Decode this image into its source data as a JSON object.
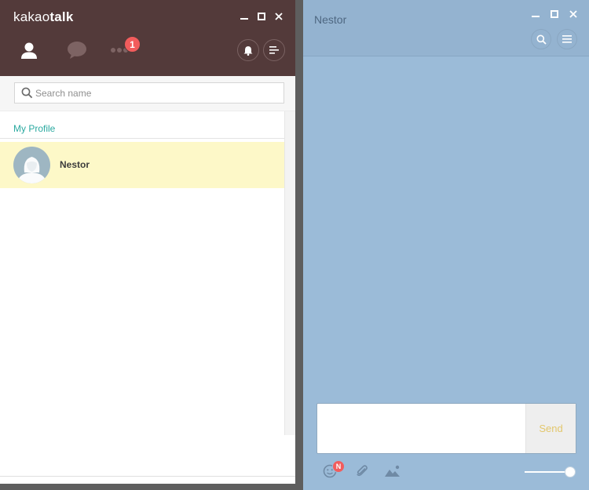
{
  "app": {
    "logo_light": "kakao",
    "logo_bold": "talk"
  },
  "main_window": {
    "nav_tabs": [
      {
        "id": "friends",
        "icon": "person-icon",
        "active": true
      },
      {
        "id": "chats",
        "icon": "speech-bubble-icon",
        "active": false
      },
      {
        "id": "more",
        "icon": "more-dots-icon",
        "active": false
      }
    ],
    "more_badge": "1",
    "search": {
      "placeholder": "Search name",
      "value": ""
    },
    "section_title": "My Profile",
    "profile": {
      "name": "Nestor"
    }
  },
  "chat_window": {
    "title": "Nestor",
    "send_label": "Send",
    "emoticon_badge": "N",
    "message_value": "",
    "opacity_level": 1.0
  },
  "colors": {
    "header_bg": "#533a3a",
    "chat_bg": "#9bbbd8",
    "accent_teal": "#2aa9a0",
    "badge_red": "#f25c5c",
    "selected_row": "#fdf8c8",
    "send_text": "#e3c76c"
  }
}
